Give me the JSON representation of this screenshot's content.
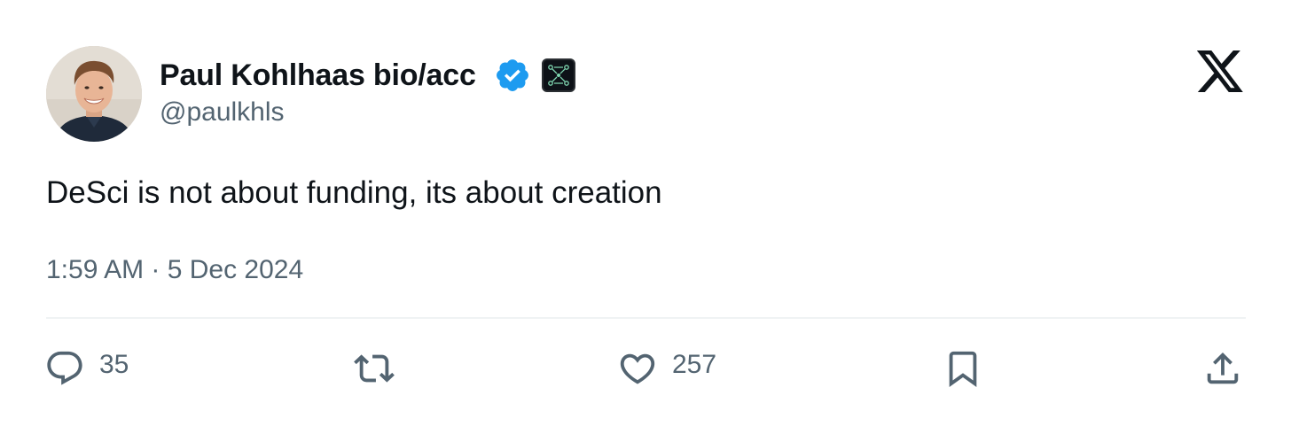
{
  "author": {
    "display_name": "Paul Kohlhaas bio/acc",
    "handle": "@paulkhls",
    "verified": true,
    "verified_color": "#1d9bf0",
    "affiliate_icon": "network-badge-icon"
  },
  "platform": {
    "logo_icon": "x-logo-icon"
  },
  "tweet": {
    "text": "DeSci is not about funding, its about creation",
    "timestamp": "1:59 AM · 5 Dec 2024"
  },
  "actions": {
    "reply": {
      "icon": "reply-icon",
      "count": "35"
    },
    "retweet": {
      "icon": "retweet-icon",
      "count": ""
    },
    "like": {
      "icon": "heart-icon",
      "count": "257"
    },
    "bookmark": {
      "icon": "bookmark-icon"
    },
    "share": {
      "icon": "share-icon"
    }
  },
  "colors": {
    "text_primary": "#0f1419",
    "text_secondary": "#536471",
    "divider": "#eff3f4"
  }
}
